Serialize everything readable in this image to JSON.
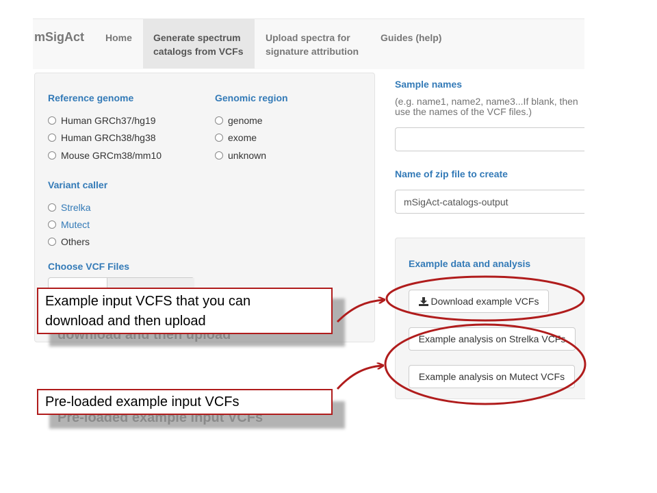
{
  "navbar": {
    "brand": "mSigAct",
    "home": "Home",
    "generate_line1": "Generate spectrum",
    "generate_line2": "catalogs from VCFs",
    "upload_line1": "Upload spectra for",
    "upload_line2": "signature attribution",
    "guides": "Guides (help)"
  },
  "reference_genome": {
    "label": "Reference genome",
    "options": [
      "Human GRCh37/hg19",
      "Human GRCh38/hg38",
      "Mouse GRCm38/mm10"
    ]
  },
  "genomic_region": {
    "label": "Genomic region",
    "options": [
      "genome",
      "exome",
      "unknown"
    ]
  },
  "variant_caller": {
    "label": "Variant caller",
    "options": [
      "Strelka",
      "Mutect",
      "Others"
    ]
  },
  "choose_vcf": {
    "label": "Choose VCF Files"
  },
  "sample_names": {
    "label": "Sample names",
    "help_line1": "(e.g. name1, name2, name3...If blank, then",
    "help_line2": "use the names of the VCF files.)",
    "value": ""
  },
  "zip_file": {
    "label": "Name of zip file to create",
    "value": "mSigAct-catalogs-output"
  },
  "example_panel": {
    "title": "Example data and analysis",
    "download_button": "Download example VCFs",
    "strelka_button": "Example analysis on Strelka VCFs",
    "mutect_button": "Example analysis on Mutect VCFs"
  },
  "annotations": {
    "callout1_line1": "Example input VCFS that you can",
    "callout1_line2": "download and then upload",
    "callout1_shadow_text": "download and then upload",
    "callout2": "Pre-loaded example input VCFs",
    "callout2_shadow_text": "Pre-loaded example input VCFs"
  },
  "colors": {
    "accent": "#337ab7",
    "annotation_red": "#b01c1c"
  }
}
